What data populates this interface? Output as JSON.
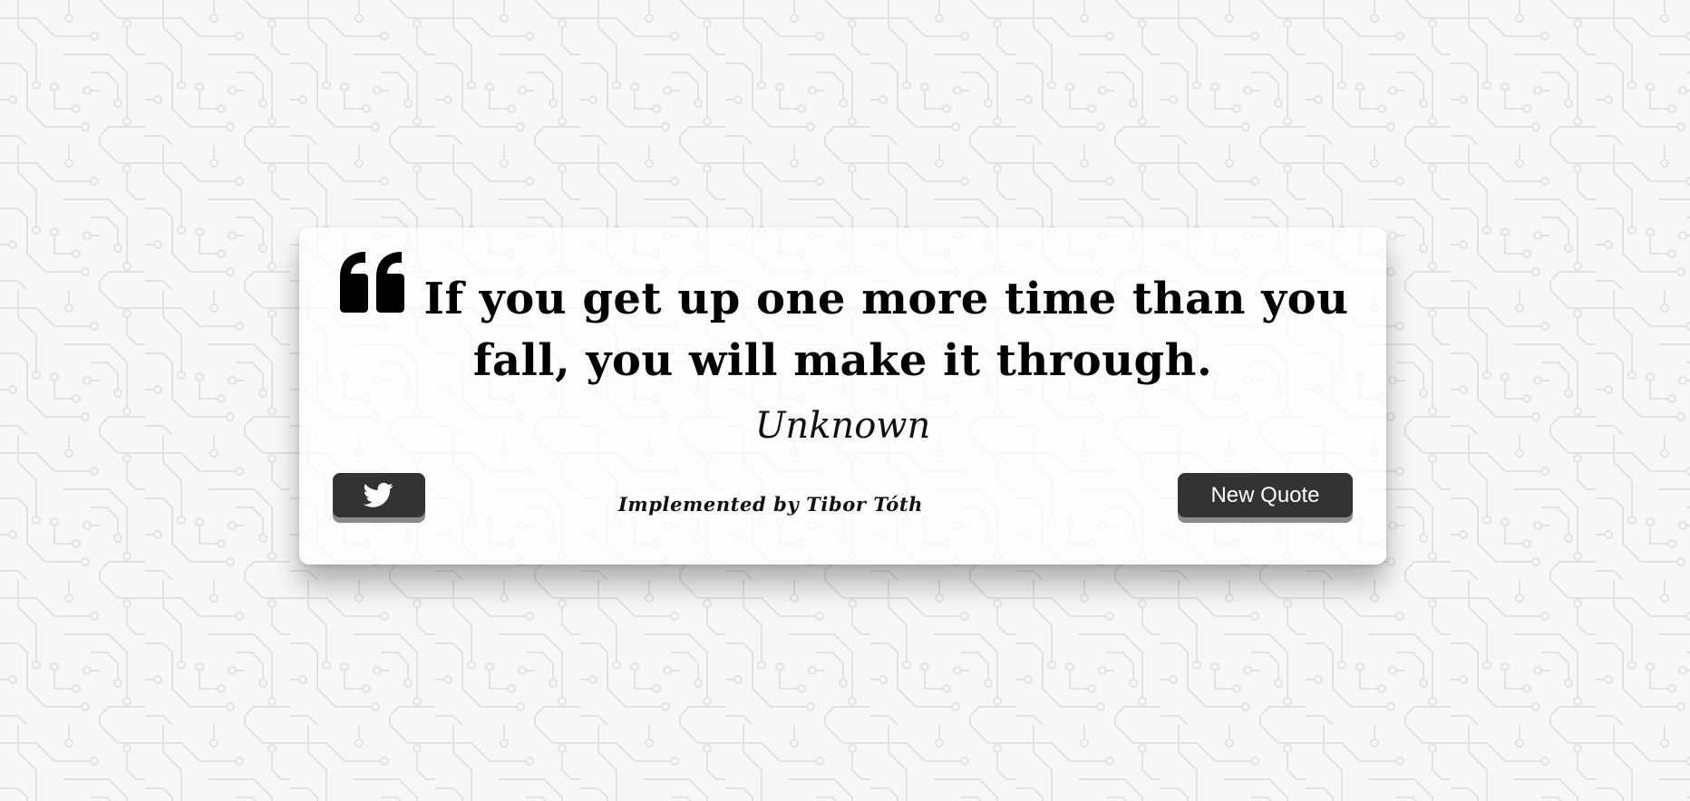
{
  "background": {
    "pattern": "circuit-board",
    "base_color": "#f7f7f7",
    "line_color": "#e4e4e4"
  },
  "quote": {
    "icon": "quote-left-icon",
    "text": "If you get up one more time than you fall, you will make it through.",
    "author": "Unknown"
  },
  "actions": {
    "tweet_icon": "twitter-icon",
    "new_quote_label": "New Quote",
    "button_color": "#333333"
  },
  "footer": {
    "credit": "Implemented by Tibor Tóth"
  }
}
